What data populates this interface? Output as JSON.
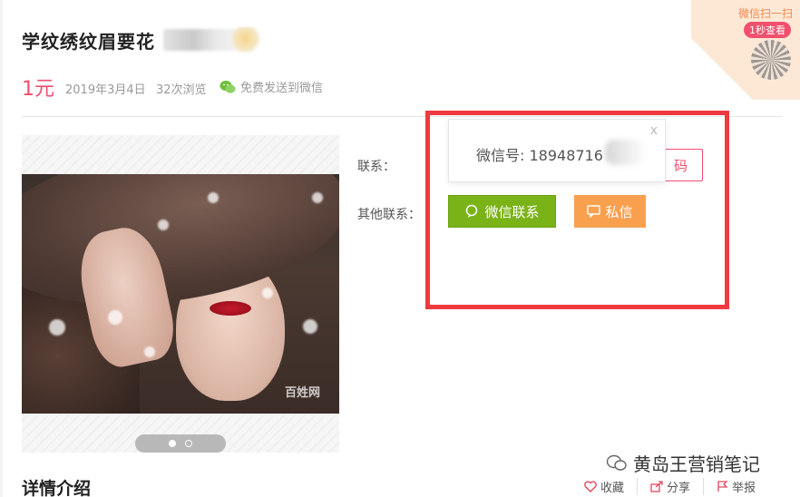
{
  "listing": {
    "title": "学纹绣纹眉要花",
    "price": "1元",
    "date": "2019年3月4日",
    "views": "32次浏览",
    "send_to_wechat": "免费发送到微信"
  },
  "qr_promo": {
    "text": "微信扫一扫",
    "badge": "1秒查看"
  },
  "contact": {
    "label": "联系：",
    "other_label": "其他联系：",
    "code_button_tail": "码",
    "wechat_popup": {
      "text": "微信号: 18948716",
      "close": "x"
    },
    "wechat_button": "微信联系",
    "message_button": "私信"
  },
  "gallery": {
    "watermark": "百姓网",
    "page_count": 2,
    "active_page": 1
  },
  "details": {
    "section_title": "详情介绍",
    "actions": [
      "收藏",
      "分享",
      "举报"
    ]
  },
  "brand_watermark": "黄岛王营销笔记",
  "colors": {
    "accent": "#f0506e",
    "wechat_green": "#7ab317",
    "message_orange": "#f9a04f",
    "highlight_red": "#ef3a3f"
  }
}
